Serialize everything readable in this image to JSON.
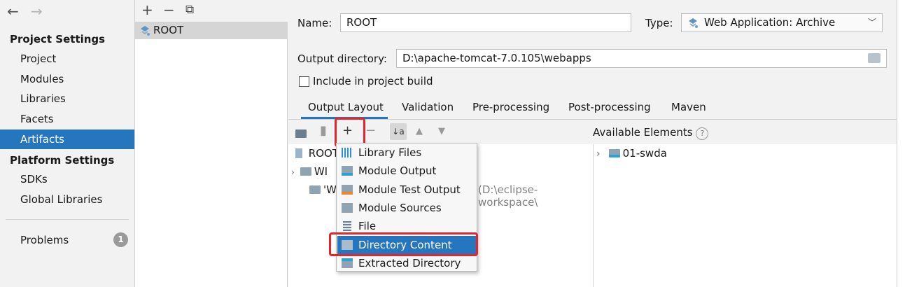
{
  "nav": {
    "back": "←",
    "forward": "→"
  },
  "sidebar": {
    "project_settings_heading": "Project Settings",
    "project_items": [
      "Project",
      "Modules",
      "Libraries",
      "Facets",
      "Artifacts"
    ],
    "selected": "Artifacts",
    "platform_settings_heading": "Platform Settings",
    "platform_items": [
      "SDKs",
      "Global Libraries"
    ],
    "problems_label": "Problems",
    "problems_count": "1"
  },
  "artifact_list": {
    "toolbar": {
      "add": "+",
      "remove": "−",
      "copy": "⧉"
    },
    "items": [
      "ROOT"
    ]
  },
  "form": {
    "name_label": "Name:",
    "name_value": "ROOT",
    "type_label": "Type:",
    "type_value": "Web Application: Archive",
    "output_dir_label": "Output directory:",
    "output_dir_value": "D:\\apache-tomcat-7.0.105\\webapps",
    "include_label": "Include in project build",
    "include_checked": false
  },
  "tabs": [
    "Output Layout",
    "Validation",
    "Pre-processing",
    "Post-processing",
    "Maven"
  ],
  "active_tab": "Output Layout",
  "layout_toolbar": {
    "add": "+",
    "remove": "−",
    "sort": "↓a z",
    "up": "▲",
    "down": "▼"
  },
  "tree": {
    "root": "ROOT",
    "child1": "WI",
    "child2": "'W",
    "clipped_path": "(D:\\eclipse-workspace\\"
  },
  "available": {
    "heading": "Available Elements",
    "help": "?",
    "items": [
      "01-swda"
    ]
  },
  "popup_menu": {
    "items": [
      "Library Files",
      "Module Output",
      "Module Test Output",
      "Module Sources",
      "File",
      "Directory Content",
      "Extracted Directory"
    ],
    "highlighted": "Directory Content"
  },
  "colors": {
    "accent": "#2675bf",
    "annotation": "#e3262b"
  }
}
